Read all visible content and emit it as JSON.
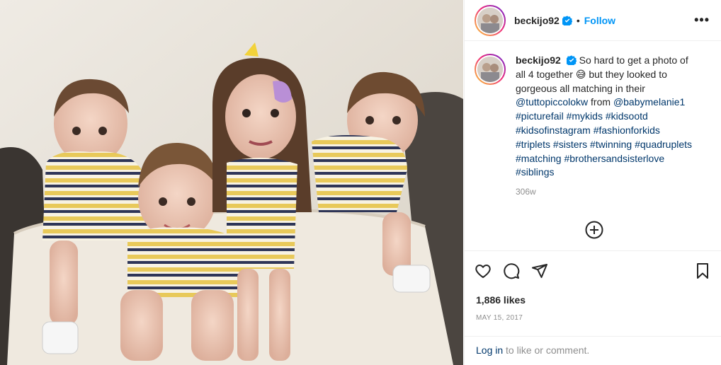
{
  "post": {
    "username": "beckijo92",
    "dot": "•",
    "follow_label": "Follow",
    "more_label": "•••"
  },
  "caption": {
    "username": "beckijo92",
    "text_1": "So hard to get a photo of all 4 together",
    "emoji": "😅",
    "text_2": "but they looked to gorgeous all matching in their",
    "mention_1": "@tuttopiccolokw",
    "text_3": "from",
    "mention_2": "@babymelanie1",
    "hashtags": [
      "#picturefail",
      "#mykids",
      "#kidsootd",
      "#kidsofinstagram",
      "#fashionforkids",
      "#triplets",
      "#sisters",
      "#twinning",
      "#quadruplets",
      "#matching",
      "#brothersandsisterlove",
      "#siblings"
    ],
    "time": "306w"
  },
  "likes": "1,886 likes",
  "date": "MAY 15, 2017",
  "login": {
    "link": "Log in",
    "text": "to like or comment."
  },
  "icons": {
    "verified": "verified-badge-icon",
    "add_comment": "plus-circle-icon",
    "like": "heart-icon",
    "comment": "comment-bubble-icon",
    "share": "paper-plane-icon",
    "save": "bookmark-icon"
  },
  "colors": {
    "link": "#0095f6",
    "tag": "#00376b",
    "muted": "#8e8e8e"
  }
}
